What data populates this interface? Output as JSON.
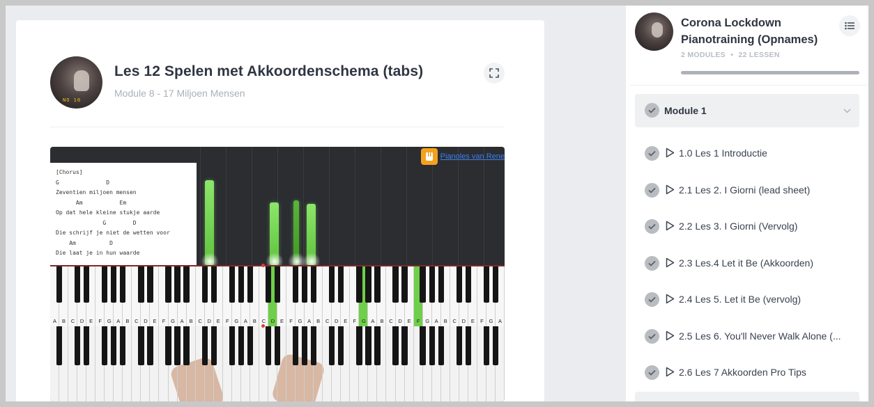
{
  "lesson": {
    "title": "Les 12 Spelen met Akkoordenschema (tabs)",
    "subtitle": "Module 8 - 17 Miljoen Mensen"
  },
  "video": {
    "brand": "Pianoles van Rene",
    "chord_sheet": [
      "[Chorus]",
      "G              D",
      "Zeventien miljoen mensen",
      "      Am           Em",
      "Op dat hele kleine stukje aarde",
      "              G        D",
      "Die schrijf je niet de wetten voor",
      "    Am          D",
      "Die laat je in hun waarde"
    ],
    "note_labels": [
      "A",
      "B",
      "C",
      "D",
      "E",
      "F",
      "G",
      "A",
      "B",
      "C",
      "D",
      "E",
      "F",
      "G",
      "A",
      "B",
      "C",
      "D",
      "E",
      "F",
      "G",
      "A",
      "B",
      "C",
      "D",
      "E",
      "F",
      "G",
      "A",
      "B",
      "C",
      "D",
      "E",
      "F",
      "G",
      "A",
      "B",
      "C",
      "D",
      "E",
      "F",
      "G",
      "A",
      "B",
      "C",
      "D",
      "E",
      "F",
      "G",
      "A"
    ]
  },
  "course": {
    "title": "Corona Lockdown Pianotraining (Opnames)",
    "meta_modules": "2 MODULES",
    "meta_dot": "•",
    "meta_lessons": "22 LESSEN",
    "progress": 1.0
  },
  "module": {
    "label": "Module 1"
  },
  "lessons": [
    {
      "label": "1.0 Les 1 Introductie"
    },
    {
      "label": "2.1 Les 2. I Giorni (lead sheet)"
    },
    {
      "label": "2.2 Les 3. I Giorni (Vervolg)"
    },
    {
      "label": "2.3 Les.4 Let it Be (Akkoorden)"
    },
    {
      "label": "2.4 Les 5. Let it Be (vervolg)"
    },
    {
      "label": "2.5 Les 6. You'll Never Walk Alone (..."
    },
    {
      "label": "2.6 Les 7 Akkoorden Pro Tips"
    }
  ],
  "colors": {
    "highlight_key": "#6fcf4a",
    "brand": "#f4a11e",
    "check": "#b9bcc0"
  }
}
